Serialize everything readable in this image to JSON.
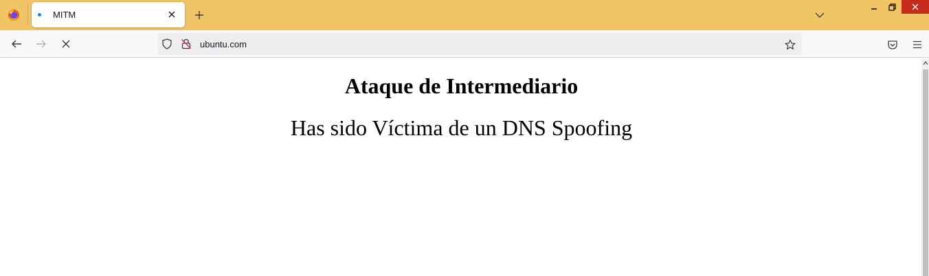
{
  "browser": {
    "tab": {
      "title": "MITM"
    },
    "url": "ubuntu.com",
    "colors": {
      "tabstrip": "#f1c565",
      "close_button": "#c42b1c",
      "loading_dot": "#0a84ff"
    },
    "icons": {
      "logo": "firefox-logo-icon",
      "tab_close": "close-icon",
      "new_tab": "plus-icon",
      "list_tabs": "chevron-down-icon",
      "back": "arrow-left-icon",
      "forward": "arrow-right-icon",
      "stop": "stop-x-icon",
      "tracking": "shield-icon",
      "insecure": "lock-warning-icon",
      "bookmark": "star-icon",
      "pocket": "pocket-icon",
      "menu": "hamburger-menu-icon"
    }
  },
  "page": {
    "heading": "Ataque de Intermediario",
    "text": "Has sido Víctima de un DNS Spoofing"
  }
}
